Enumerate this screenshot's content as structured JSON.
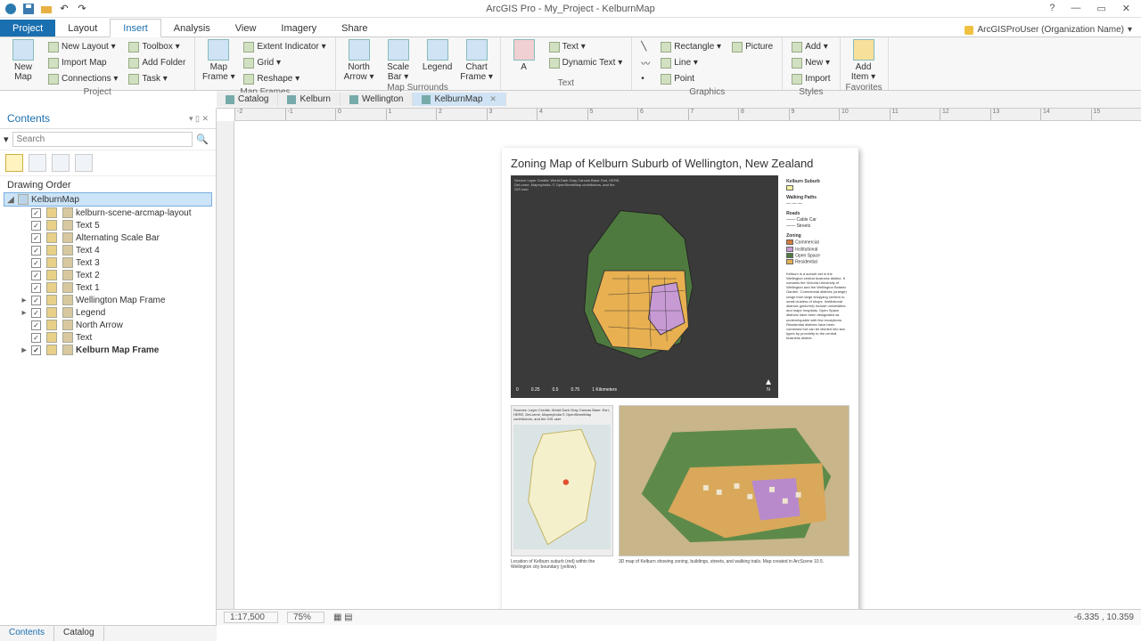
{
  "app": {
    "title": "ArcGIS Pro - My_Project - KelburnMap"
  },
  "user": {
    "label": "ArcGISProUser (Organization Name)"
  },
  "tabs": {
    "file": "Project",
    "layout": "Layout",
    "insert": "Insert",
    "analysis": "Analysis",
    "view": "View",
    "imagery": "Imagery",
    "share": "Share"
  },
  "ribbon": {
    "project": {
      "group": "Project",
      "newmap": "New\nMap",
      "newlayout": "New Layout ▾",
      "importmap": "Import Map",
      "connections": "Connections ▾",
      "toolbox": "Toolbox ▾",
      "addfolder": "Add Folder",
      "task": "Task ▾"
    },
    "mapframes": {
      "group": "Map Frames",
      "mapframe": "Map\nFrame ▾",
      "extent": "Extent Indicator ▾",
      "grid": "Grid ▾",
      "reshape": "Reshape ▾"
    },
    "surrounds": {
      "group": "Map Surrounds",
      "north": "North\nArrow ▾",
      "scale": "Scale\nBar ▾",
      "legend": "Legend",
      "chart": "Chart\nFrame ▾"
    },
    "text": {
      "group": "Text",
      "text": "Text ▾",
      "dyn": "Dynamic Text ▾"
    },
    "graphics": {
      "group": "Graphics",
      "rect": "Rectangle ▾",
      "line": "Line ▾",
      "point": "Point",
      "pic": "Picture"
    },
    "styles": {
      "group": "Styles",
      "add": "Add ▾",
      "new": "New ▾",
      "import": "Import"
    },
    "fav": {
      "group": "Favorites",
      "additem": "Add\nItem ▾"
    }
  },
  "view_tabs": {
    "catalog": "Catalog",
    "kelburn": "Kelburn",
    "wellington": "Wellington",
    "kelburnmap": "KelburnMap"
  },
  "contents": {
    "title": "Contents",
    "search_placeholder": "Search",
    "section": "Drawing Order",
    "root": "KelburnMap",
    "items": [
      {
        "label": "kelburn-scene-arcmap-layout",
        "bold": false,
        "expand": ""
      },
      {
        "label": "Text 5",
        "bold": false,
        "expand": ""
      },
      {
        "label": "Alternating Scale Bar",
        "bold": false,
        "expand": ""
      },
      {
        "label": "Text 4",
        "bold": false,
        "expand": ""
      },
      {
        "label": "Text 3",
        "bold": false,
        "expand": ""
      },
      {
        "label": "Text 2",
        "bold": false,
        "expand": ""
      },
      {
        "label": "Text 1",
        "bold": false,
        "expand": ""
      },
      {
        "label": "Wellington Map Frame",
        "bold": false,
        "expand": "▸"
      },
      {
        "label": "Legend",
        "bold": false,
        "expand": "▸"
      },
      {
        "label": "North Arrow",
        "bold": false,
        "expand": ""
      },
      {
        "label": "Text",
        "bold": false,
        "expand": ""
      },
      {
        "label": "Kelburn Map Frame",
        "bold": true,
        "expand": "▸"
      }
    ],
    "footer": {
      "contents": "Contents",
      "catalog": "Catalog"
    }
  },
  "layout": {
    "title": "Zoning Map of Kelburn Suburb of Wellington, New Zealand",
    "credits": "Service Layer Credits: World Dark Gray Canvas Base: Esri, HERE, DeLorme, MapmyIndia, © OpenStreetMap contributors, and the GIS user",
    "legend": {
      "suburb": "Kelburn Suburb",
      "paths": "Walking Paths",
      "roads": "Roads",
      "r1": "Cable Car",
      "r2": "Streets",
      "zoning": "Zoning",
      "z1": "Commercial",
      "z2": "Institutional",
      "z3": "Open Space",
      "z4": "Residential",
      "blurb": "Kelburn is a suburb set in the Wellington central business district. It contains the Victoria University of Wellington and the Wellington Botanic Garden.\n\nCommercial districts (orange) range from large shopping centers to small clusters of shops. Institutional districts (pink/red) include universities and major hospitals. Open Space districts have been designated as undevelopable with few exceptions. Residential districts have been combined but can be divided into two types by proximity to the central business district."
    },
    "scalebar": {
      "a": "0",
      "b": "0.25",
      "c": "0.5",
      "d": "0.75",
      "e": "1 Kilometers"
    },
    "overview_credits": "Sources: Layer Credits: World Dark Gray Canvas Base: Esri, HERE, DeLorme, MapmyIndia © OpenStreetMap contributors, and the GIS user",
    "caption1": "Location of Kelburn suburb (red) within the Wellington city boundary (yellow).",
    "caption2": "3D map of Kelburn showing zoning, buildings, streets, and walking trails. Map created in ArcScene 10.5."
  },
  "status": {
    "scale": "1:17,500",
    "zoom": "75%",
    "coords": "-6.335 , 10.359"
  },
  "ruler": [
    "-2",
    "-1",
    "0",
    "1",
    "2",
    "3",
    "4",
    "5",
    "6",
    "7",
    "8",
    "9",
    "10",
    "11",
    "12",
    "13",
    "14",
    "15"
  ]
}
